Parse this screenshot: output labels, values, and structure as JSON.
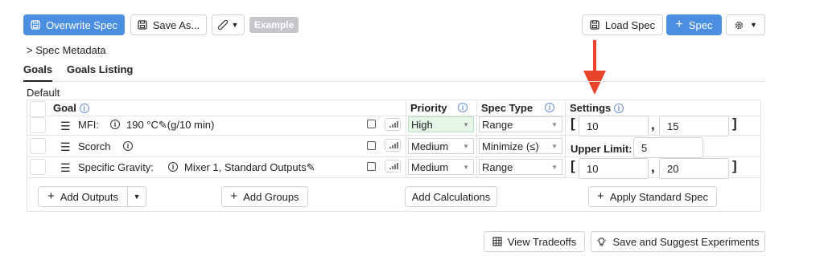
{
  "toolbar": {
    "overwrite_label": "Overwrite Spec",
    "save_as_label": "Save As...",
    "example_label": "Example",
    "load_label": "Load Spec",
    "add_spec_label": "Spec"
  },
  "spec_metadata_label": "Spec Metadata",
  "tabs": [
    {
      "label": "Goals"
    },
    {
      "label": "Goals Listing"
    }
  ],
  "section_label": "Default",
  "headers": {
    "goal": "Goal",
    "priority": "Priority",
    "spec_type": "Spec Type",
    "settings": "Settings"
  },
  "rows": [
    {
      "name": "MFI:",
      "detail": "190 °C",
      "unit": "(g/10 min)",
      "priority": "High",
      "spec_type": "Range",
      "low": "10",
      "high": "15"
    },
    {
      "name": "Scorch",
      "priority": "Medium",
      "spec_type": "Minimize (≤)",
      "upper_label": "Upper Limit:",
      "upper": "5"
    },
    {
      "name": "Specific Gravity:",
      "detail": "Mixer 1, Standard Outputs",
      "priority": "Medium",
      "spec_type": "Range",
      "low": "10",
      "high": "20"
    }
  ],
  "actions": {
    "add_outputs": "Add Outputs",
    "add_groups": "Add Groups",
    "add_calculations": "Add Calculations",
    "apply_standard": "Apply Standard Spec"
  },
  "footer": {
    "view_tradeoffs": "View Tradeoffs",
    "save_suggest": "Save and Suggest Experiments"
  },
  "colors": {
    "primary": "#4c8fe0",
    "arrow": "#e8442c",
    "high_bg": "#e5f6e8"
  }
}
